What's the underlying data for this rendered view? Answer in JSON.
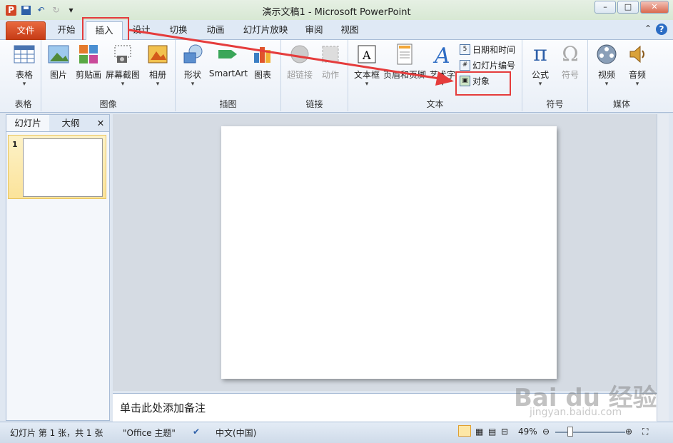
{
  "window": {
    "title": "演示文稿1 - Microsoft PowerPoint"
  },
  "tabs": [
    "文件",
    "开始",
    "插入",
    "设计",
    "切换",
    "动画",
    "幻灯片放映",
    "审阅",
    "视图"
  ],
  "ribbon": {
    "groups": {
      "table": "表格",
      "images": "图像",
      "illustrations": "插图",
      "links": "链接",
      "text": "文本",
      "symbols": "符号",
      "media": "媒体"
    },
    "buttons": {
      "table": "表格",
      "picture": "图片",
      "clipart": "剪贴画",
      "screenshot": "屏幕截图",
      "album": "相册",
      "shapes": "形状",
      "smartart": "SmartArt",
      "chart": "图表",
      "hyperlink": "超链接",
      "action": "动作",
      "textbox": "文本框",
      "header_footer": "页眉和页脚",
      "wordart": "艺术字",
      "equation": "公式",
      "symbol": "符号",
      "video": "视频",
      "audio": "音频"
    },
    "small": {
      "datetime": "日期和时间",
      "slide_number": "幻灯片编号",
      "object": "对象"
    }
  },
  "left_pane": {
    "tab_slides": "幻灯片",
    "tab_outline": "大纲",
    "slide_num": "1"
  },
  "notes": {
    "placeholder": "单击此处添加备注"
  },
  "status": {
    "slide_info": "幻灯片 第 1 张，共 1 张",
    "theme": "\"Office 主题\"",
    "language": "中文(中国)",
    "zoom": "49%"
  },
  "watermark": {
    "brand": "Bai du 经验",
    "url": "jingyan.baidu.com"
  },
  "colors": {
    "accent_red": "#e53c3c",
    "file_tab": "#d24726"
  }
}
